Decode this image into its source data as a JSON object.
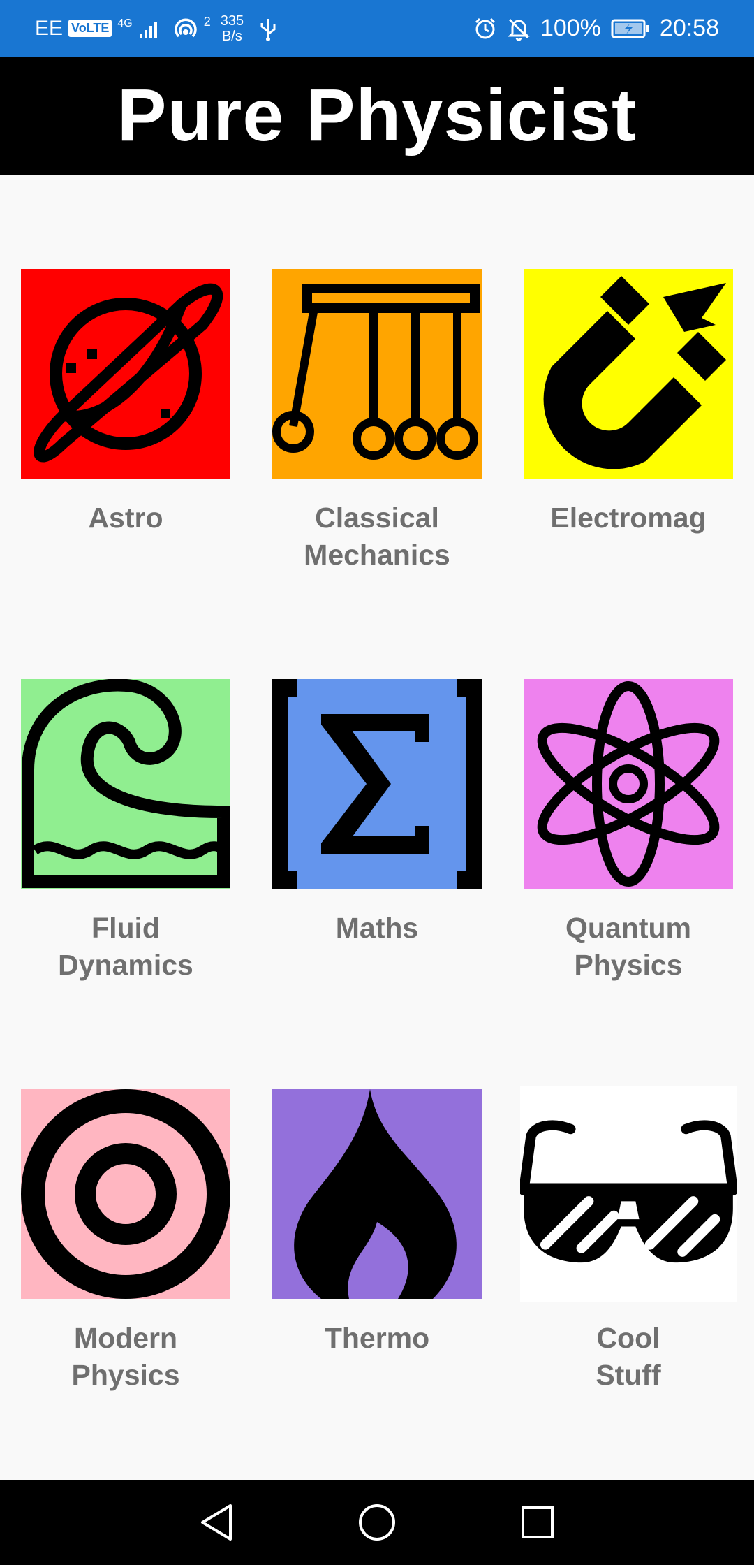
{
  "status_bar": {
    "carrier": "EE",
    "volte": "VoLTE",
    "network_type": "4G",
    "hotspot_count": "2",
    "net_speed_value": "335",
    "net_speed_unit": "B/s",
    "battery": "100%",
    "time": "20:58",
    "icons": [
      "signal-icon",
      "hotspot-icon",
      "usb-icon",
      "alarm-icon",
      "mute-icon",
      "battery-icon"
    ]
  },
  "header": {
    "title": "Pure Physicist"
  },
  "categories": [
    {
      "label": "Astro",
      "color": "#ff0000",
      "icon": "planet-icon"
    },
    {
      "label": "Classical\nMechanics",
      "color": "#ffa500",
      "icon": "newtons-cradle-icon"
    },
    {
      "label": "Electromag",
      "color": "#ffff00",
      "icon": "magnet-icon"
    },
    {
      "label": "Fluid\nDynamics",
      "color": "#90ee90",
      "icon": "wave-icon"
    },
    {
      "label": "Maths",
      "color": "#6495ed",
      "icon": "sigma-icon"
    },
    {
      "label": "Quantum\nPhysics",
      "color": "#ee82ee",
      "icon": "atom-icon"
    },
    {
      "label": "Modern\nPhysics",
      "color": "#ffb6c1",
      "icon": "target-icon"
    },
    {
      "label": "Thermo",
      "color": "#9370db",
      "icon": "flame-icon"
    },
    {
      "label": "Cool\nStuff",
      "color": "#ffffff",
      "icon": "sunglasses-icon"
    }
  ],
  "nav_bar": {
    "buttons": [
      "back-icon",
      "home-icon",
      "recents-icon"
    ]
  }
}
